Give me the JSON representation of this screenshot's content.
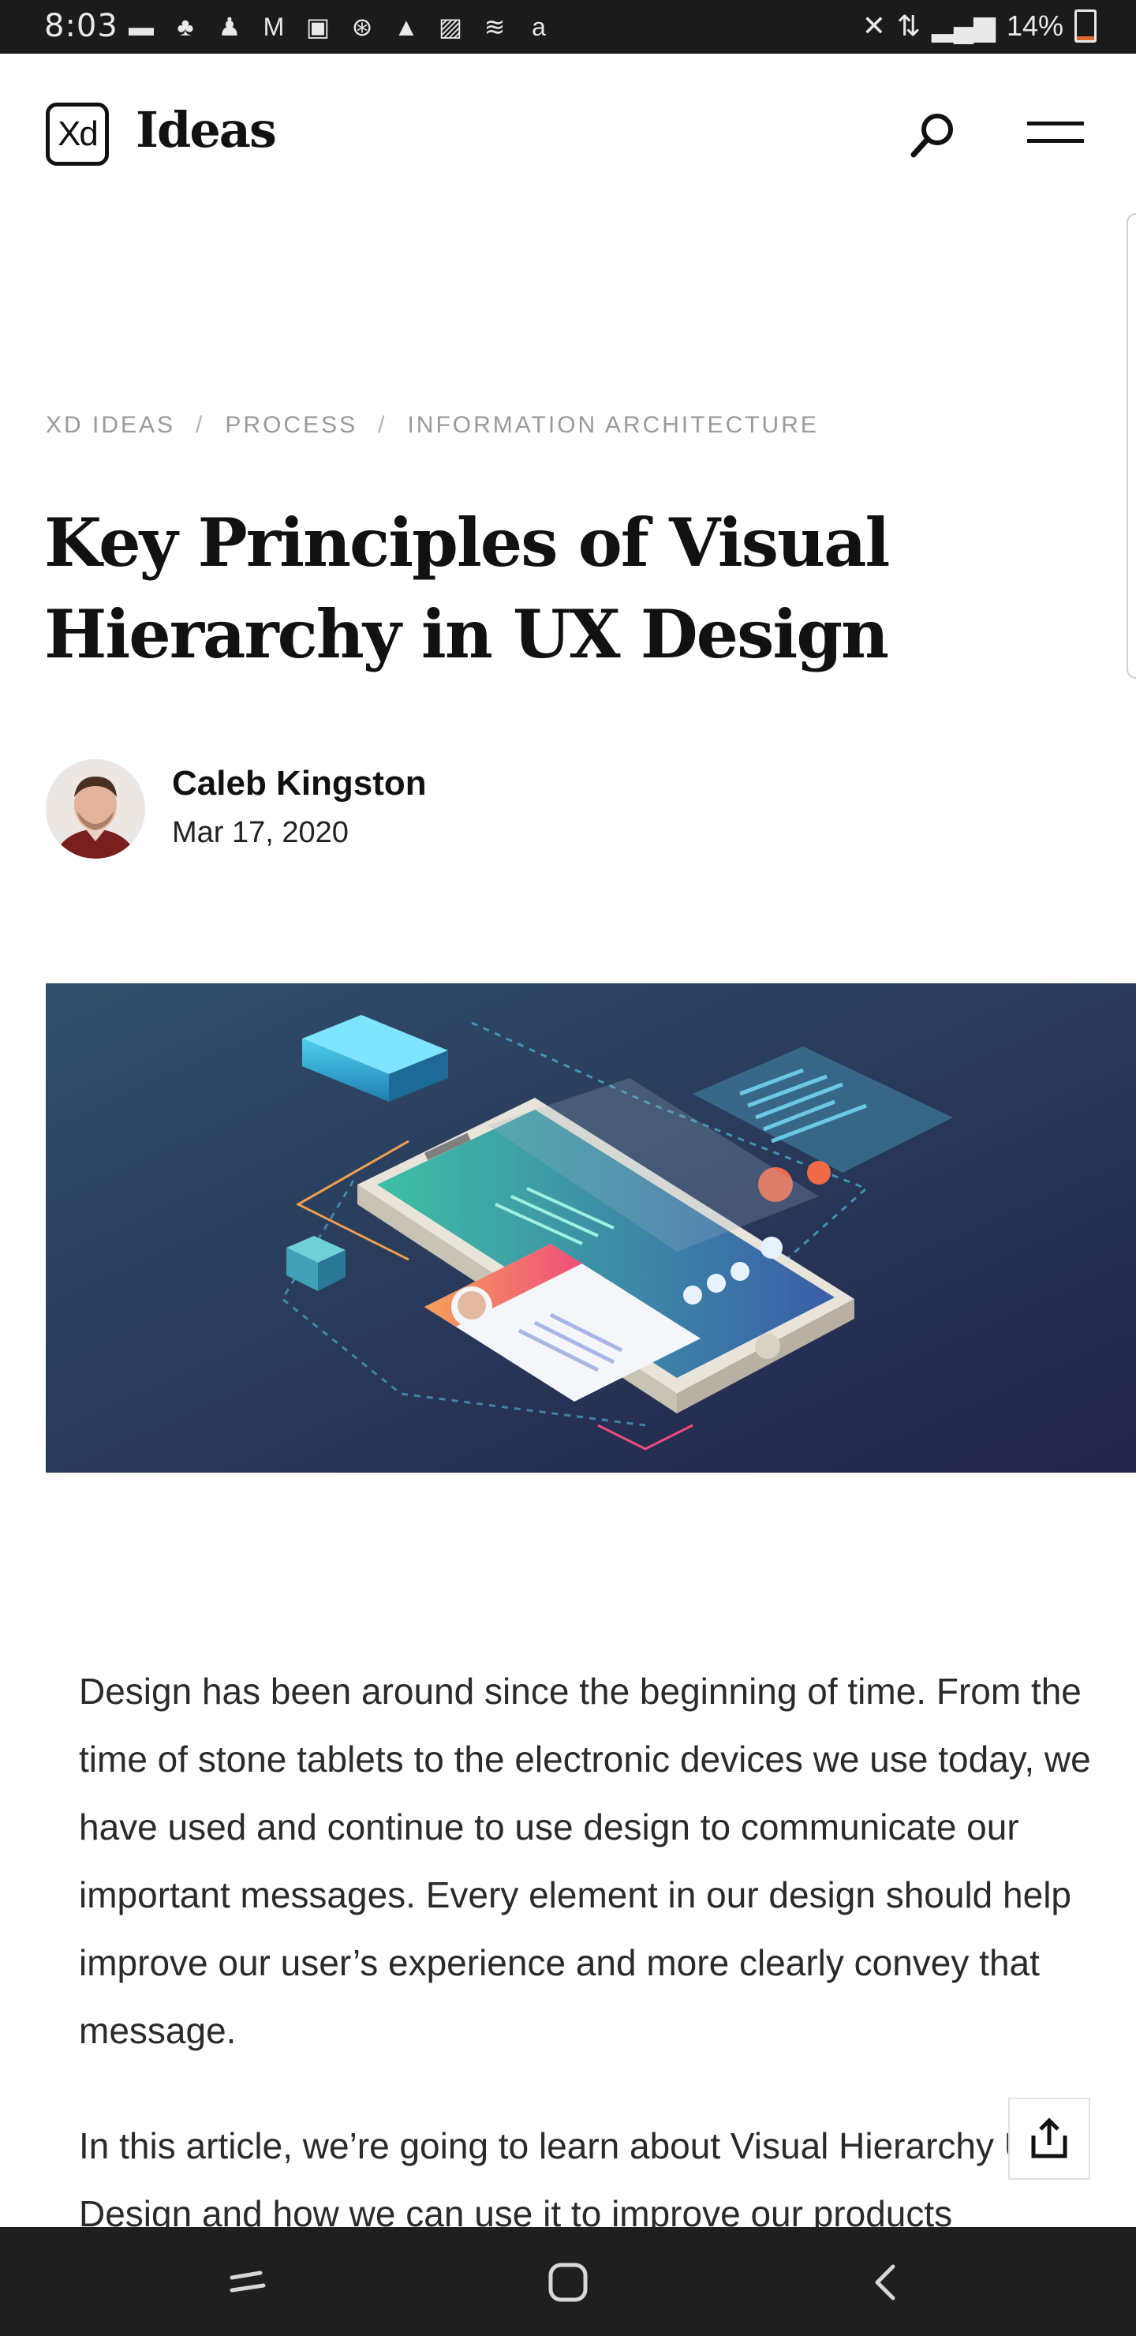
{
  "status_bar": {
    "time": "8:03",
    "notification_icons": [
      "message-icon",
      "snapchat-icon",
      "person-icon",
      "gmail-icon",
      "outlook-icon",
      "refresh-icon",
      "warning-icon",
      "image-icon",
      "wifi-calling-icon",
      "amazon-icon"
    ],
    "right_icons": [
      "mute-icon",
      "data-icon",
      "signal-icon"
    ],
    "battery_percent": "14%",
    "battery_level": 0.14
  },
  "header": {
    "logo_mark": "Xd",
    "logo_text": "Ideas"
  },
  "breadcrumb": {
    "items": [
      "XD IDEAS",
      "PROCESS",
      "INFORMATION ARCHITECTURE"
    ],
    "separator": "/"
  },
  "article": {
    "title": "Key Principles of Visual Hierarchy in UX Design",
    "author": "Caleb Kingston",
    "date": "Mar 17, 2020",
    "paragraphs": [
      "Design has been around since the beginning of time. From the time of stone tablets to the electronic devices we use today, we have used and continue to use design to communicate our important messages. Every element in our design should help improve our user’s experience and more clearly convey that message.",
      "In this article, we’re going to learn about Visual Hierarchy UX Design and how we can use it to improve our products"
    ]
  },
  "colors": {
    "status_bar_bg": "#1b1b1b",
    "nav_bar_bg": "#1f1f1f",
    "text": "#1a1a1a",
    "breadcrumb": "#9a9a9a",
    "battery": "#e06a2c"
  }
}
